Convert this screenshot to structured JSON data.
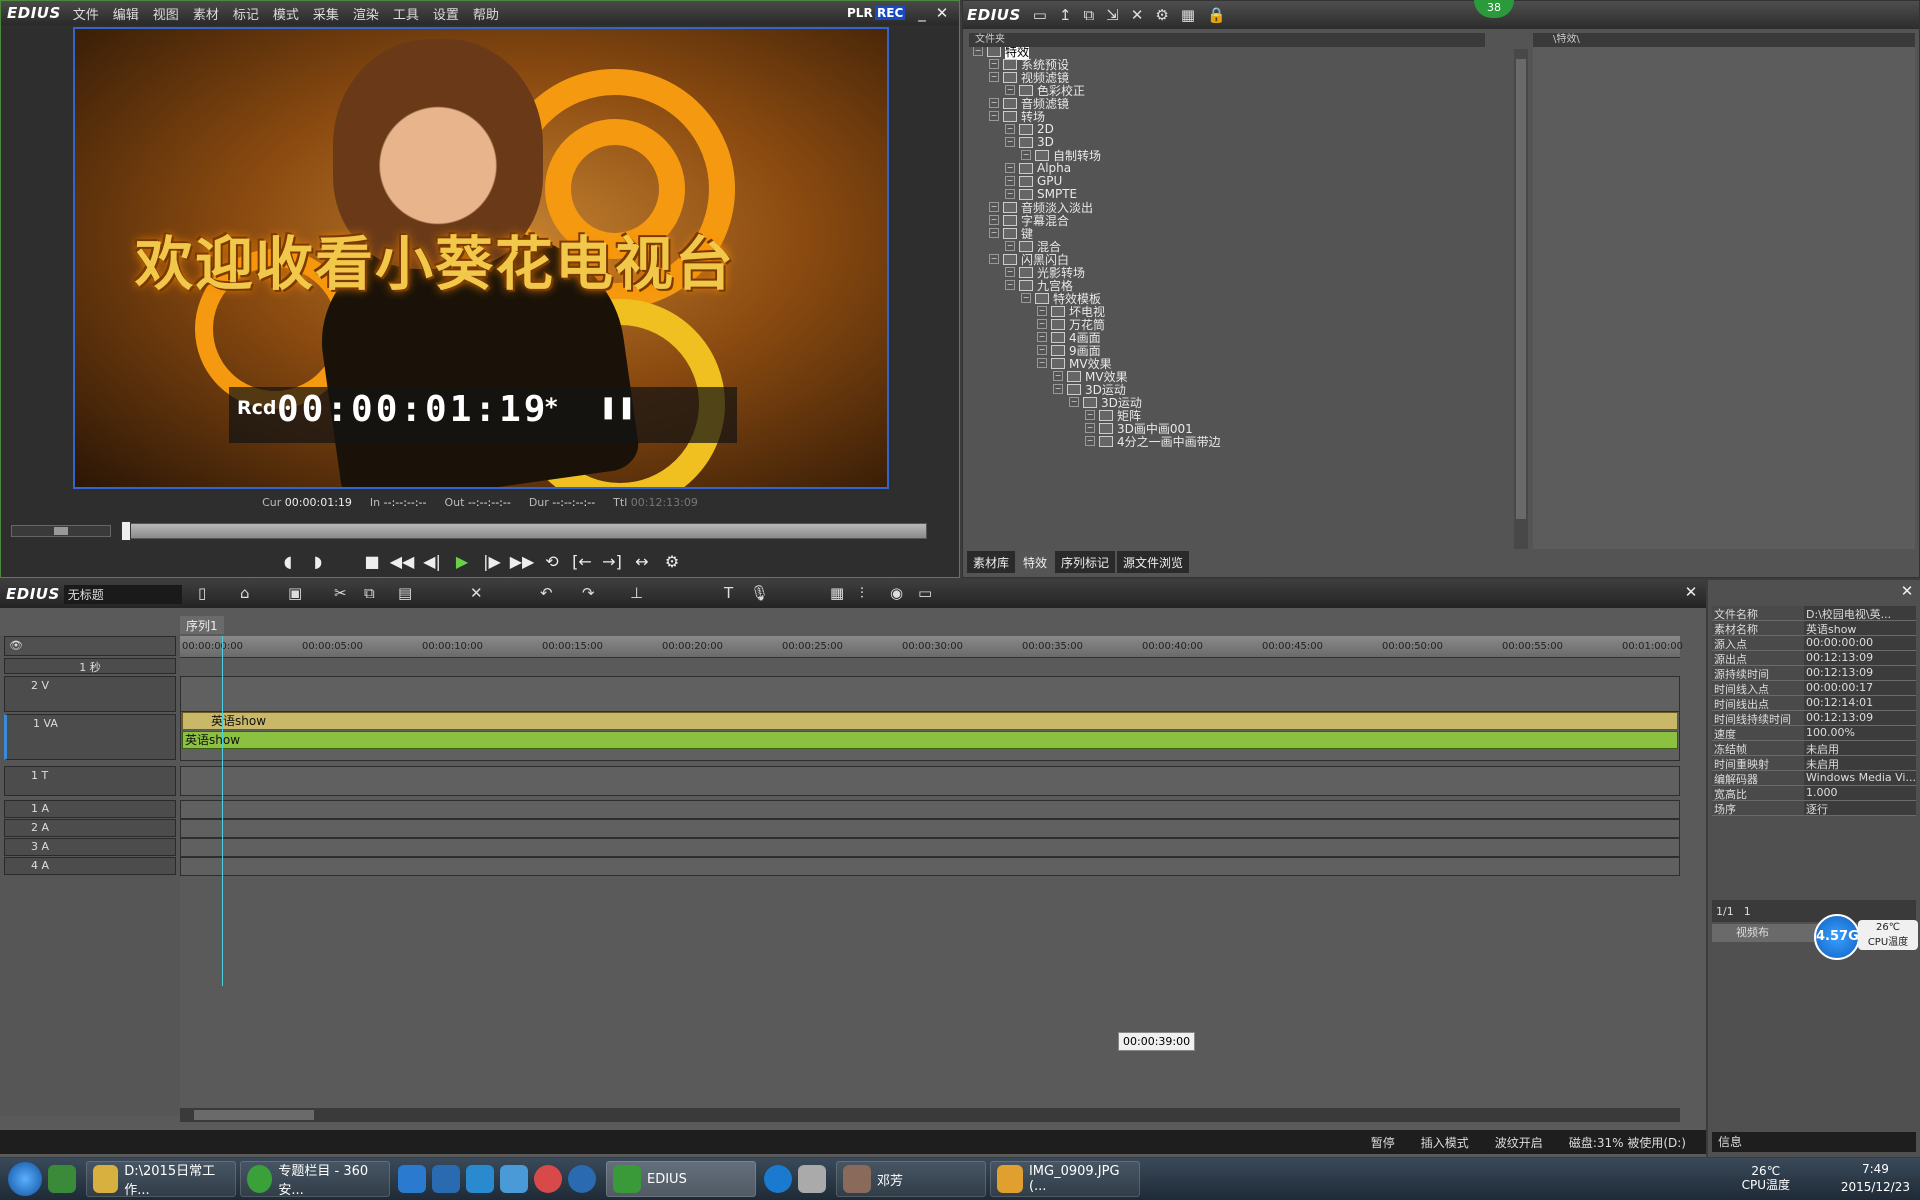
{
  "player": {
    "logo": "EDIUS",
    "menu": [
      "文件",
      "编辑",
      "视图",
      "素材",
      "标记",
      "模式",
      "采集",
      "渲染",
      "工具",
      "设置",
      "帮助"
    ],
    "mode_plr": "PLR",
    "mode_rec": "REC",
    "video_title": "欢迎收看小葵花电视台",
    "rcd_label": "Rcd",
    "timecode": "00:00:01:19",
    "tc_star": "*",
    "cur_label": "Cur",
    "cur_value": "00:00:01:19",
    "in_label": "In",
    "in_value": "--:--:--:--",
    "out_label": "Out",
    "out_value": "--:--:--:--",
    "dur_label": "Dur",
    "dur_value": "--:--:--:--",
    "ttl_label": "Ttl",
    "ttl_value": "00:12:13:09"
  },
  "effects": {
    "logo": "EDIUS",
    "badge": "38",
    "folder_header": "文件夹",
    "right_header": "\\特效\\",
    "tree": [
      {
        "t": "特效",
        "d": 0,
        "s": true
      },
      {
        "t": "系统预设",
        "d": 1
      },
      {
        "t": "视频滤镜",
        "d": 1
      },
      {
        "t": "色彩校正",
        "d": 2
      },
      {
        "t": "音频滤镜",
        "d": 1
      },
      {
        "t": "转场",
        "d": 1
      },
      {
        "t": "2D",
        "d": 2
      },
      {
        "t": "3D",
        "d": 2
      },
      {
        "t": "自制转场",
        "d": 3
      },
      {
        "t": "Alpha",
        "d": 2
      },
      {
        "t": "GPU",
        "d": 2
      },
      {
        "t": "SMPTE",
        "d": 2
      },
      {
        "t": "音频淡入淡出",
        "d": 1
      },
      {
        "t": "字幕混合",
        "d": 1
      },
      {
        "t": "键",
        "d": 1
      },
      {
        "t": "混合",
        "d": 2
      },
      {
        "t": "闪黑闪白",
        "d": 1
      },
      {
        "t": "光影转场",
        "d": 2
      },
      {
        "t": "九宫格",
        "d": 2
      },
      {
        "t": "特效模板",
        "d": 3
      },
      {
        "t": "坏电视",
        "d": 4
      },
      {
        "t": "万花筒",
        "d": 4
      },
      {
        "t": "4画面",
        "d": 4
      },
      {
        "t": "9画面",
        "d": 4
      },
      {
        "t": "MV效果",
        "d": 4
      },
      {
        "t": "MV效果",
        "d": 5
      },
      {
        "t": "3D运动",
        "d": 5
      },
      {
        "t": "3D运动",
        "d": 6
      },
      {
        "t": "矩阵",
        "d": 7
      },
      {
        "t": "3D画中画001",
        "d": 7
      },
      {
        "t": "4分之一画中画带边",
        "d": 7
      }
    ],
    "tabs": [
      "素材库",
      "特效",
      "序列标记",
      "源文件浏览"
    ]
  },
  "timeline": {
    "logo": "EDIUS",
    "project": "无标题",
    "sequence": "序列1",
    "scale": "1 秒",
    "ruler": [
      "00:00:00:00",
      "00:00:05:00",
      "00:00:10:00",
      "00:00:15:00",
      "00:00:20:00",
      "00:00:25:00",
      "00:00:30:00",
      "00:00:35:00",
      "00:00:40:00",
      "00:00:45:00",
      "00:00:50:00",
      "00:00:55:00",
      "00:01:00:00"
    ],
    "tracks": [
      "2 V",
      "1 VA",
      "1 T",
      "1 A",
      "2 A",
      "3 A",
      "4 A"
    ],
    "clip_video": "英语show",
    "clip_audio": "英语show",
    "tooltip": "00:00:39:00",
    "status": [
      "暂停",
      "插入模式",
      "波纹开启",
      "磁盘:31% 被使用(D:)"
    ]
  },
  "info": {
    "rows": [
      [
        "文件名称",
        "D:\\校园电视\\英..."
      ],
      [
        "素材名称",
        "英语show"
      ],
      [
        "源入点",
        "00:00:00:00"
      ],
      [
        "源出点",
        "00:12:13:09"
      ],
      [
        "源持续时间",
        "00:12:13:09"
      ],
      [
        "时间线入点",
        "00:00:00:17"
      ],
      [
        "时间线出点",
        "00:12:14:01"
      ],
      [
        "时间线持续时间",
        "00:12:13:09"
      ],
      [
        "速度",
        "100.00%"
      ],
      [
        "冻结帧",
        "未启用"
      ],
      [
        "时间重映射",
        "未启用"
      ],
      [
        "编解码器",
        "Windows Media Vi..."
      ],
      [
        "宽高比",
        "1.000"
      ],
      [
        "场序",
        "逐行"
      ]
    ],
    "page": "1/1",
    "count": "1",
    "item": "视频布",
    "footer": "信息",
    "cpu_value": "4.57G",
    "temp": "26℃",
    "temp_label": "CPU温度"
  },
  "taskbar": {
    "items": [
      "D:\\2015日常工作...",
      "专题栏目 - 360安...",
      "EDIUS",
      "邓芳",
      "IMG_0909.JPG (..."
    ],
    "clock_time": "7:49",
    "clock_date": "2015/12/23",
    "tray_temp": "26℃",
    "tray_label": "CPU温度"
  }
}
